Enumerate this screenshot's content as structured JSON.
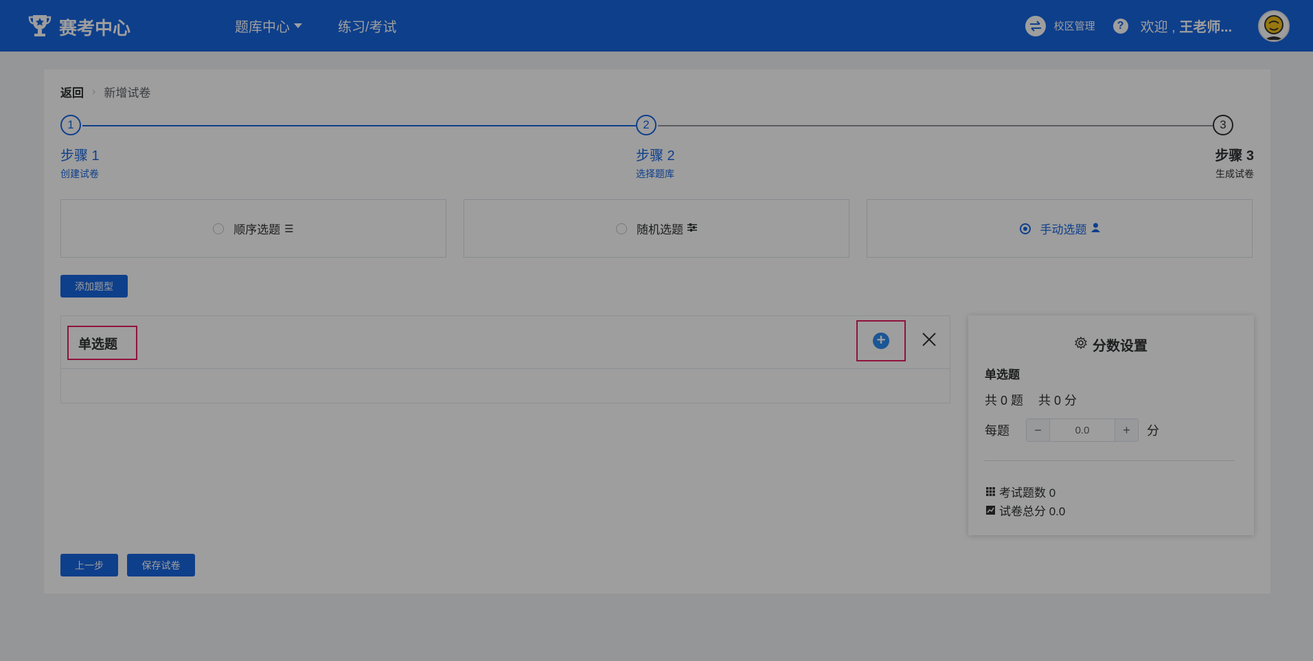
{
  "header": {
    "app_title": "赛考中心",
    "nav": [
      {
        "label": "题库中心",
        "has_dropdown": true
      },
      {
        "label": "练习/考试",
        "has_dropdown": false
      }
    ],
    "campus_label": "校区管理",
    "welcome_prefix": "欢迎 , ",
    "welcome_name": "王老师...",
    "icons": {
      "logo": "trophy-icon",
      "campus": "swap-icon",
      "help": "question-icon",
      "avatar": "user-avatar"
    }
  },
  "breadcrumb": {
    "back": "返回",
    "current": "新增试卷"
  },
  "steps": [
    {
      "num": "1",
      "title": "步骤 1",
      "desc": "创建试卷",
      "state": "done"
    },
    {
      "num": "2",
      "title": "步骤 2",
      "desc": "选择题库",
      "state": "done"
    },
    {
      "num": "3",
      "title": "步骤 3",
      "desc": "生成试卷",
      "state": "current"
    }
  ],
  "modes": [
    {
      "label": "顺序选题",
      "selected": false,
      "icon": "list-icon"
    },
    {
      "label": "随机选题",
      "selected": false,
      "icon": "sliders-icon"
    },
    {
      "label": "手动选题",
      "selected": true,
      "icon": "user-icon"
    }
  ],
  "add_type_button": "添加题型",
  "question_panel": {
    "type_title": "单选题"
  },
  "score": {
    "title": "分数设置",
    "type": "单选题",
    "count_text": "共 0 题",
    "points_text": "共 0 分",
    "each_label": "每题",
    "each_value": "0.0",
    "minus": "−",
    "plus": "+",
    "unit": "分",
    "exam_count": "考试题数 0",
    "total_score": "试卷总分 0.0"
  },
  "footer": {
    "prev": "上一步",
    "save": "保存试卷"
  },
  "colors": {
    "primary": "#1866e0",
    "highlight": "#e91e63",
    "overlay": "rgba(0,0,0,0.38)"
  }
}
